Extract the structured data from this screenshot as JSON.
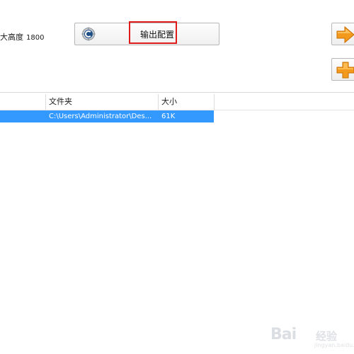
{
  "settings": {
    "height_label": "大高度",
    "height_value": "1800"
  },
  "toolbar": {
    "config_label": "输出配置",
    "config_icon": "gear-icon",
    "next_icon": "orange-arrow-right-icon",
    "add_icon": "orange-plus-icon"
  },
  "file_list": {
    "columns": [
      "",
      "文件夹",
      "大小"
    ],
    "rows": [
      {
        "folder": "C:\\Users\\Administrator\\Des...",
        "size": "61K",
        "selected": true
      }
    ]
  },
  "watermark": {
    "logo": "Bai",
    "text": "经验",
    "url": "jingyan.baidu.com"
  },
  "colors": {
    "selection": "#3399ff",
    "highlight_border": "#e01b1b",
    "accent_orange": "#f39a1e"
  }
}
